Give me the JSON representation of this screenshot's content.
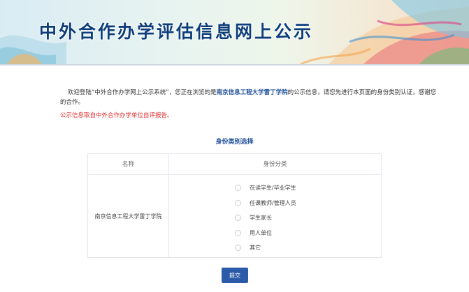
{
  "banner": {
    "title": "中外合作办学评估信息网上公示"
  },
  "intro": {
    "prefix": "欢迎登陆“中外合作办学网上公示系统”，您正在浏览的是",
    "school": "南京信息工程大学雷丁学院",
    "suffix": "的公示信息，请您先进行本页面的身份类别认证，感谢您的合作。",
    "notice": "公示信息取自中外合作办学单位自评报告。"
  },
  "section": {
    "title": "身份类别选择"
  },
  "table": {
    "headers": [
      "名称",
      "身份分类"
    ],
    "institution_name": "南京信息工程大学雷丁学院",
    "options": [
      "在读学生/毕业学生",
      "任课教师/管理人员",
      "学生家长",
      "用人单位",
      "其它"
    ]
  },
  "actions": {
    "submit_label": "提交"
  },
  "colors": {
    "title": "#0d3e7a",
    "notice": "#e03030",
    "button": "#2b5aa8"
  }
}
